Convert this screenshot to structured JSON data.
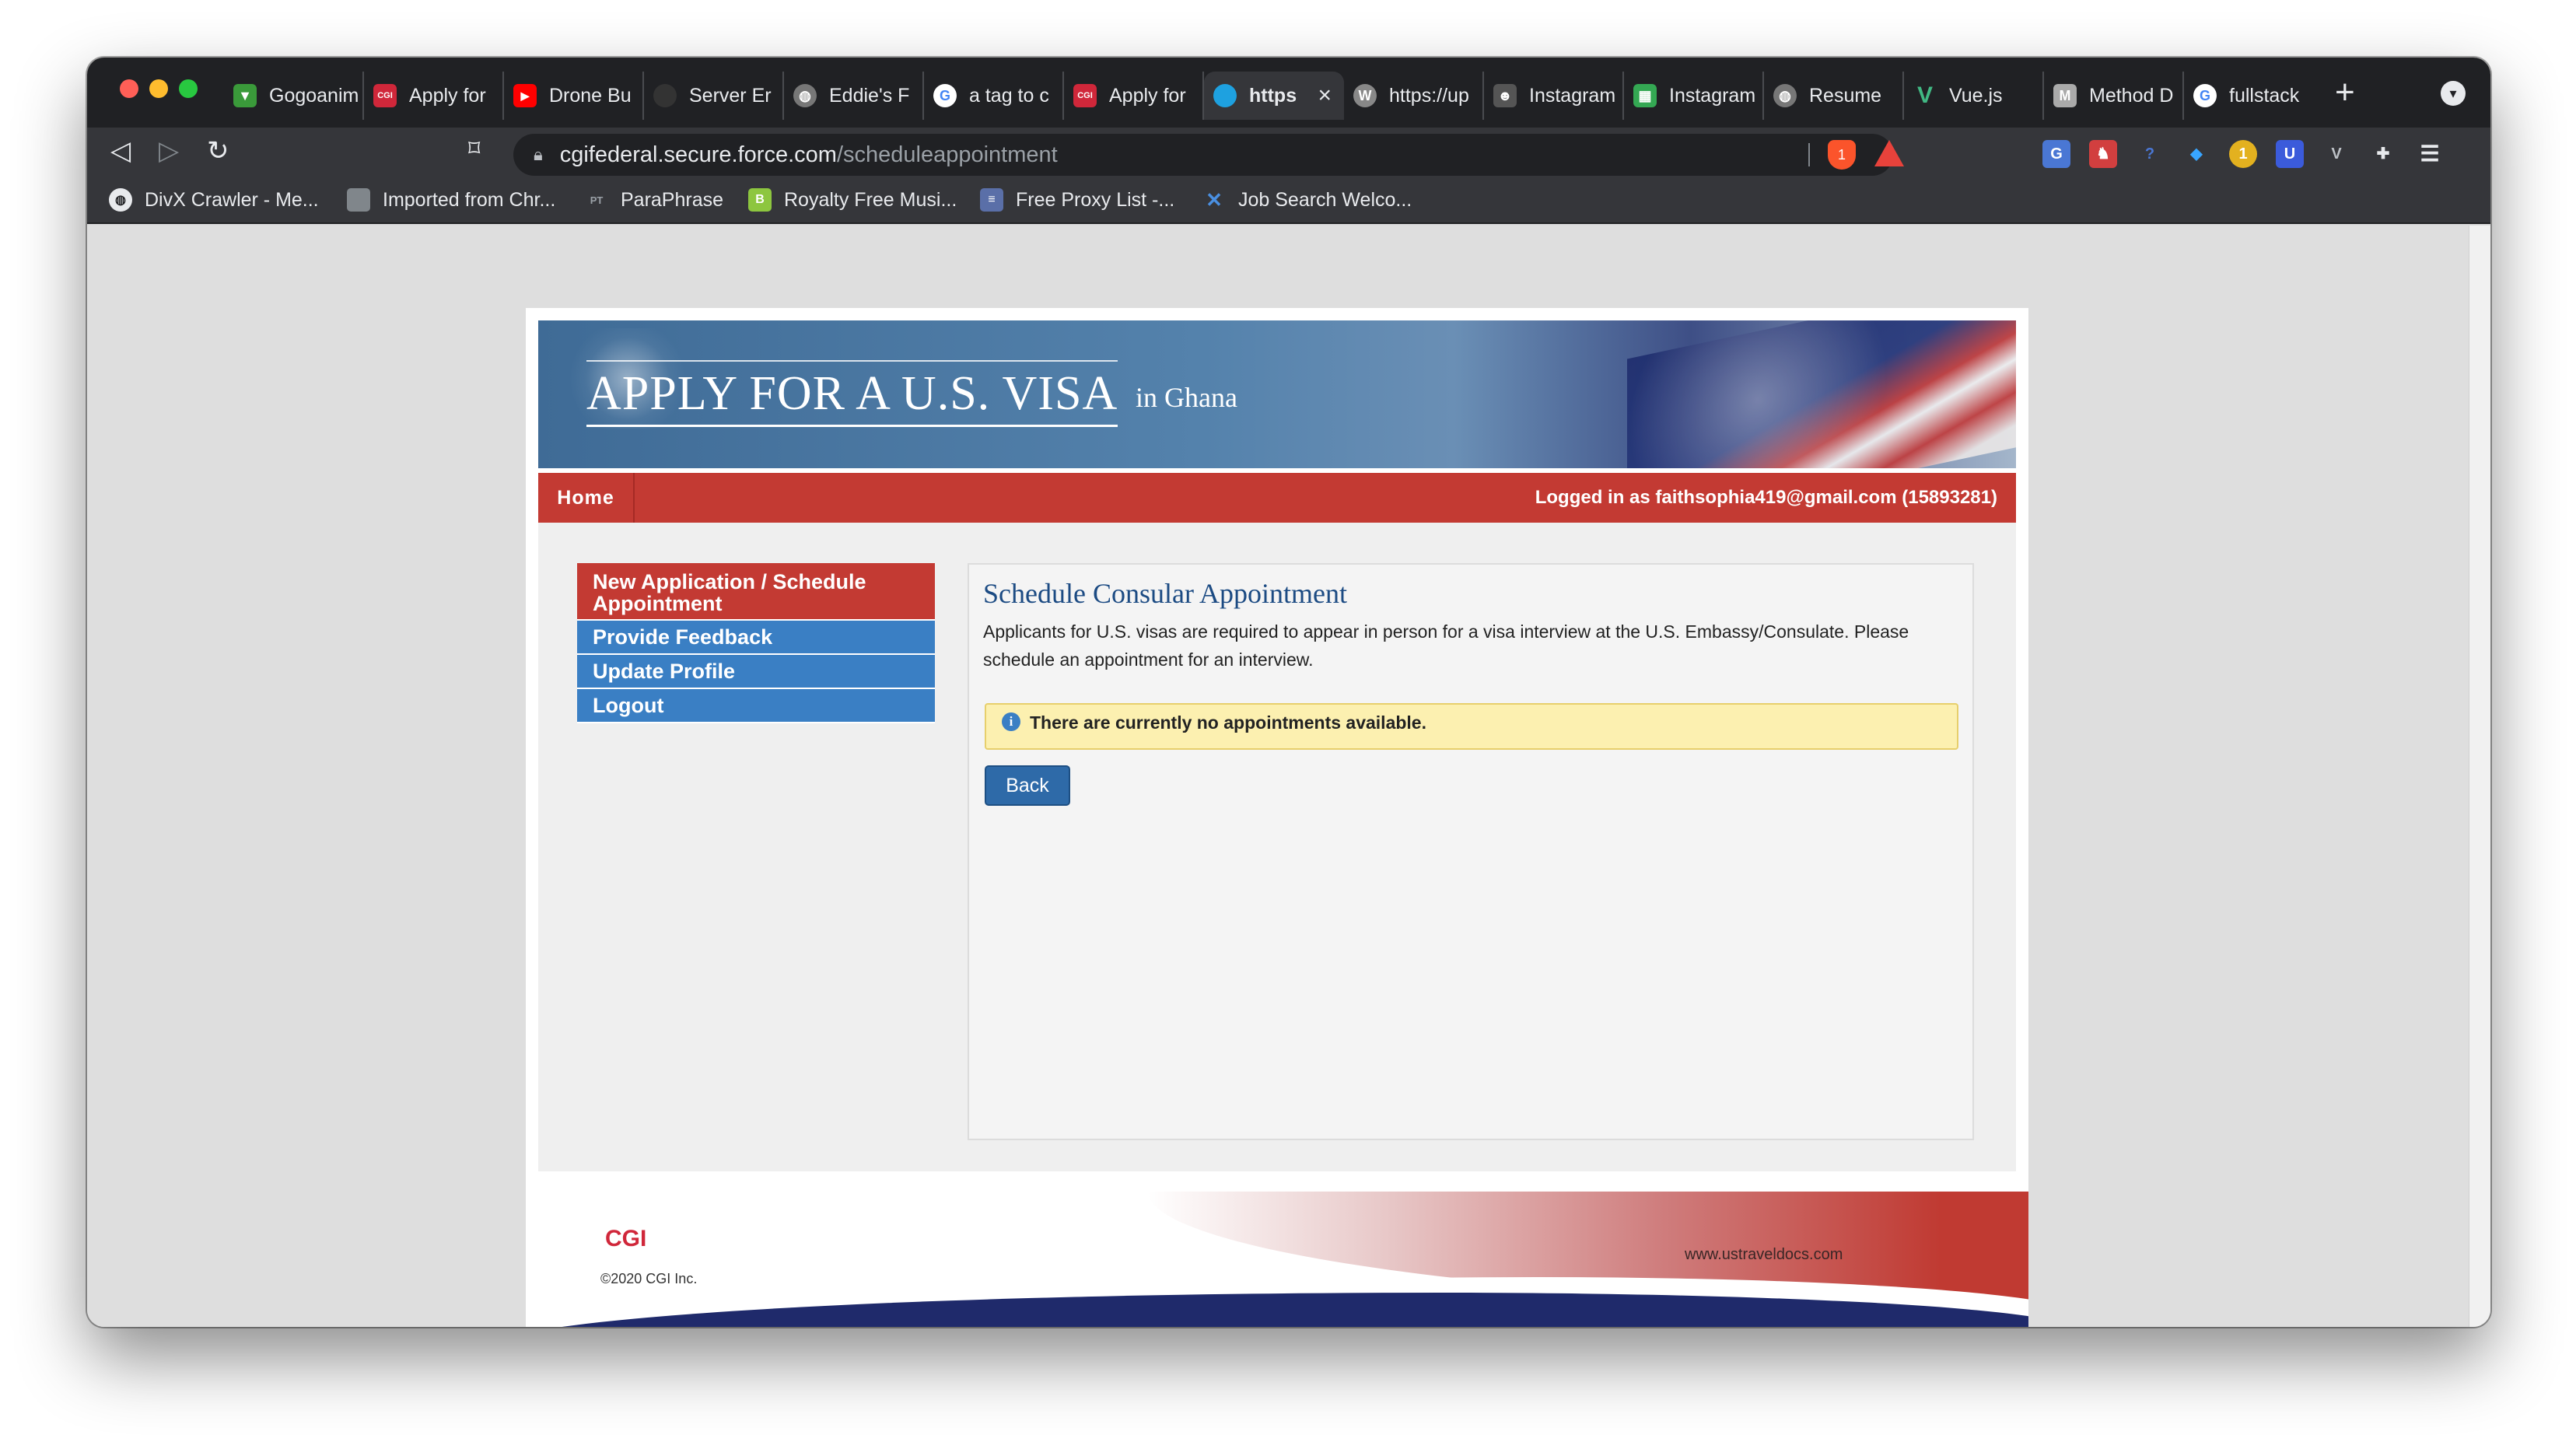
{
  "browser": {
    "tabs": [
      {
        "label": "Gogoanim",
        "icon": "gogoanime-icon",
        "color": "#3a9a3a"
      },
      {
        "label": "Apply for",
        "icon": "cgi-icon",
        "color": "#d0273a"
      },
      {
        "label": "Drone Bu",
        "icon": "youtube-icon",
        "color": "#ff0000"
      },
      {
        "label": "Server Er",
        "icon": "github-icon",
        "color": "#444444"
      },
      {
        "label": "Eddie's F",
        "icon": "globe-icon",
        "color": "#777777"
      },
      {
        "label": "a tag to c",
        "icon": "google-icon",
        "color": "#4285f4"
      },
      {
        "label": "Apply for",
        "icon": "cgi-icon",
        "color": "#d0273a"
      },
      {
        "label": "https",
        "icon": "salesforce-icon",
        "color": "#1ea1e0"
      },
      {
        "label": "https://up",
        "icon": "wikipedia-icon",
        "color": "#888888"
      },
      {
        "label": "Instagram",
        "icon": "people-icon",
        "color": "#555555"
      },
      {
        "label": "Instagram",
        "icon": "sheets-icon",
        "color": "#34a853"
      },
      {
        "label": "Resume",
        "icon": "globe-icon",
        "color": "#777777"
      },
      {
        "label": "Vue.js",
        "icon": "vue-icon",
        "color": "#41b883"
      },
      {
        "label": "Method D",
        "icon": "medium-icon",
        "color": "#aaaaaa"
      },
      {
        "label": "fullstack",
        "icon": "google-icon",
        "color": "#4285f4"
      }
    ],
    "url_host": "cgifederal.secure.force.com",
    "url_path": "/scheduleappointment",
    "brave_badge": "1",
    "ext_badge": "1",
    "bookmarks": [
      {
        "label": "DivX Crawler - Me...",
        "icon": "globe-icon"
      },
      {
        "label": "Imported from Chr...",
        "icon": "folder-icon"
      },
      {
        "label": "ParaPhrase",
        "icon": "paraphrase-icon",
        "badge": "PT"
      },
      {
        "label": "Royalty Free Musi...",
        "icon": "bensound-icon",
        "badge": "B"
      },
      {
        "label": "Free Proxy List -...",
        "icon": "proxy-icon"
      },
      {
        "label": "Job Search Welco...",
        "icon": "job-search-icon"
      }
    ]
  },
  "site": {
    "banner_title": "APPLY FOR A U.S. VISA",
    "banner_sub": "in  Ghana",
    "nav_home": "Home",
    "logged_in": "Logged in as  faithsophia419@gmail.com (15893281)",
    "menu": [
      {
        "label": "New Application / Schedule Appointment",
        "active": true
      },
      {
        "label": "Provide Feedback",
        "active": false
      },
      {
        "label": "Update Profile",
        "active": false
      },
      {
        "label": "Logout",
        "active": false
      }
    ],
    "panel_title": "Schedule Consular Appointment",
    "panel_text": "Applicants for U.S. visas are required to appear in person for a visa interview at the U.S. Embassy/Consulate. Please schedule an appointment for an interview.",
    "alert": "There are currently no appointments available.",
    "back_label": "Back",
    "footer_logo": "CGI",
    "footer_copyright": "©2020 CGI Inc.",
    "footer_url": "www.ustraveldocs.com"
  },
  "colors": {
    "accent_red": "#c33a33",
    "menu_blue": "#3a7fc4",
    "alert_yellow": "#fcf0b0",
    "title_blue": "#1c4b83"
  }
}
